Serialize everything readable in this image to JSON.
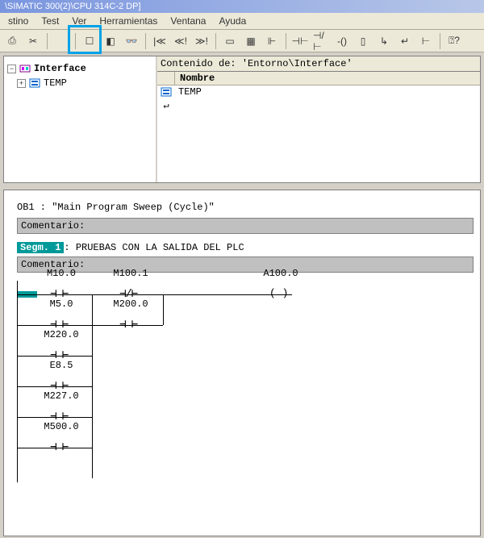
{
  "title": "\\SIMATIC 300(2)\\CPU 314C-2 DP]",
  "menu": {
    "items": [
      "stino",
      "Test",
      "Ver",
      "Herramientas",
      "Ventana",
      "Ayuda"
    ]
  },
  "toolbar": {
    "buttons": [
      {
        "name": "print-icon",
        "glyph": "⎙"
      },
      {
        "name": "cut-icon",
        "glyph": "✂"
      },
      {
        "name": "empty-icon",
        "glyph": ""
      },
      {
        "name": "toggle-icon",
        "glyph": "☐"
      },
      {
        "name": "view-icon",
        "glyph": "◧"
      },
      {
        "name": "glasses-icon",
        "glyph": "👓"
      }
    ],
    "buttons2": [
      {
        "name": "nav-start-icon",
        "glyph": "|≪"
      },
      {
        "name": "nav-prev-icon",
        "glyph": "≪!"
      },
      {
        "name": "nav-next-icon",
        "glyph": "≫!"
      }
    ],
    "buttons3": [
      {
        "name": "window-icon",
        "glyph": "▭"
      },
      {
        "name": "chart-icon",
        "glyph": "▦"
      },
      {
        "name": "segment-icon",
        "glyph": "⊩"
      },
      {
        "name": "no-contact-tool-icon",
        "glyph": "⊣⊢"
      },
      {
        "name": "nc-contact-tool-icon",
        "glyph": "⊣/⊢"
      },
      {
        "name": "coil-tool-icon",
        "glyph": "-()"
      },
      {
        "name": "box-tool-icon",
        "glyph": "▯"
      },
      {
        "name": "branch-open-icon",
        "glyph": "↳"
      },
      {
        "name": "branch-close-icon",
        "glyph": "↵"
      },
      {
        "name": "connect-icon",
        "glyph": "⊢"
      },
      {
        "name": "help-icon",
        "glyph": "⍰?"
      }
    ]
  },
  "tree": {
    "root": {
      "label": "Interface"
    },
    "child": {
      "label": "TEMP"
    }
  },
  "rightPane": {
    "contenido": "Contenido de: 'Entorno\\Interface'",
    "col_nombre": "Nombre",
    "row_temp": "TEMP"
  },
  "editor": {
    "ob_line": "OB1 :  \"Main Program Sweep (Cycle)\"",
    "comentario": "Comentario:",
    "seg_chip": "Segm. 1",
    "seg_text": ": PRUEBAS CON LA SALIDA DEL PLC",
    "ladder": {
      "m10": "M10.0",
      "m100": "M100.1",
      "a100": "A100.0",
      "m5": "M5.0",
      "m200": "M200.0",
      "m220": "M220.0",
      "e85": "E8.5",
      "m227": "M227.0",
      "m500": "M500.0"
    }
  }
}
